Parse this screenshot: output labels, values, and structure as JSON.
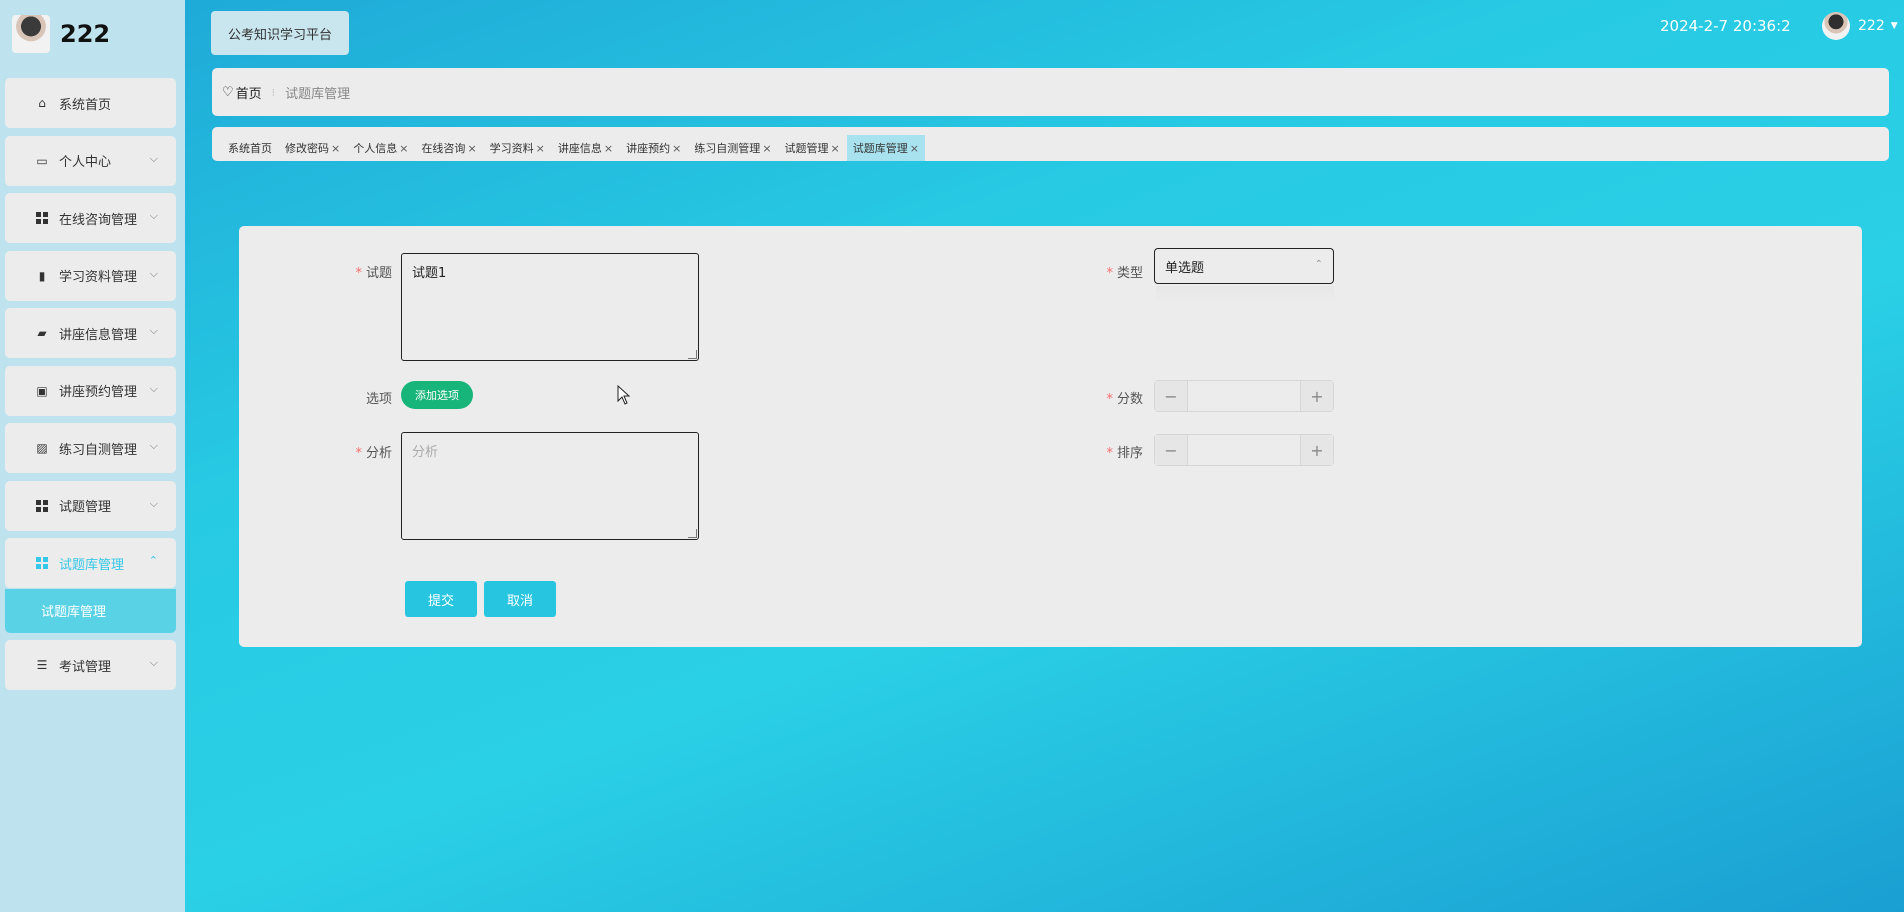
{
  "sidebar": {
    "brand": "222",
    "items": [
      {
        "label": "系统首页"
      },
      {
        "label": "个人中心"
      },
      {
        "label": "在线咨询管理"
      },
      {
        "label": "学习资料管理"
      },
      {
        "label": "讲座信息管理"
      },
      {
        "label": "讲座预约管理"
      },
      {
        "label": "练习自测管理"
      },
      {
        "label": "试题管理"
      },
      {
        "label": "试题库管理"
      },
      {
        "label": "考试管理"
      }
    ],
    "submenu_label": "试题库管理"
  },
  "header": {
    "platform": "公考知识学习平台",
    "datetime": "2024-2-7 20:36:2",
    "username": "222"
  },
  "breadcrumb": {
    "home": "首页",
    "current": "试题库管理"
  },
  "tags": [
    {
      "label": "系统首页"
    },
    {
      "label": "修改密码"
    },
    {
      "label": "个人信息"
    },
    {
      "label": "在线咨询"
    },
    {
      "label": "学习资料"
    },
    {
      "label": "讲座信息"
    },
    {
      "label": "讲座预约"
    },
    {
      "label": "练习自测管理"
    },
    {
      "label": "试题管理"
    },
    {
      "label": "试题库管理"
    }
  ],
  "tag_close": "×",
  "form": {
    "question_label": "试题",
    "question_value": "试题1",
    "type_label": "类型",
    "type_value": "单选题",
    "options_label": "选项",
    "add_option": "添加选项",
    "score_label": "分数",
    "analysis_label": "分析",
    "analysis_placeholder": "分析",
    "order_label": "排序",
    "minus": "−",
    "plus": "+",
    "submit": "提交",
    "cancel": "取消",
    "required_mark": "*"
  }
}
